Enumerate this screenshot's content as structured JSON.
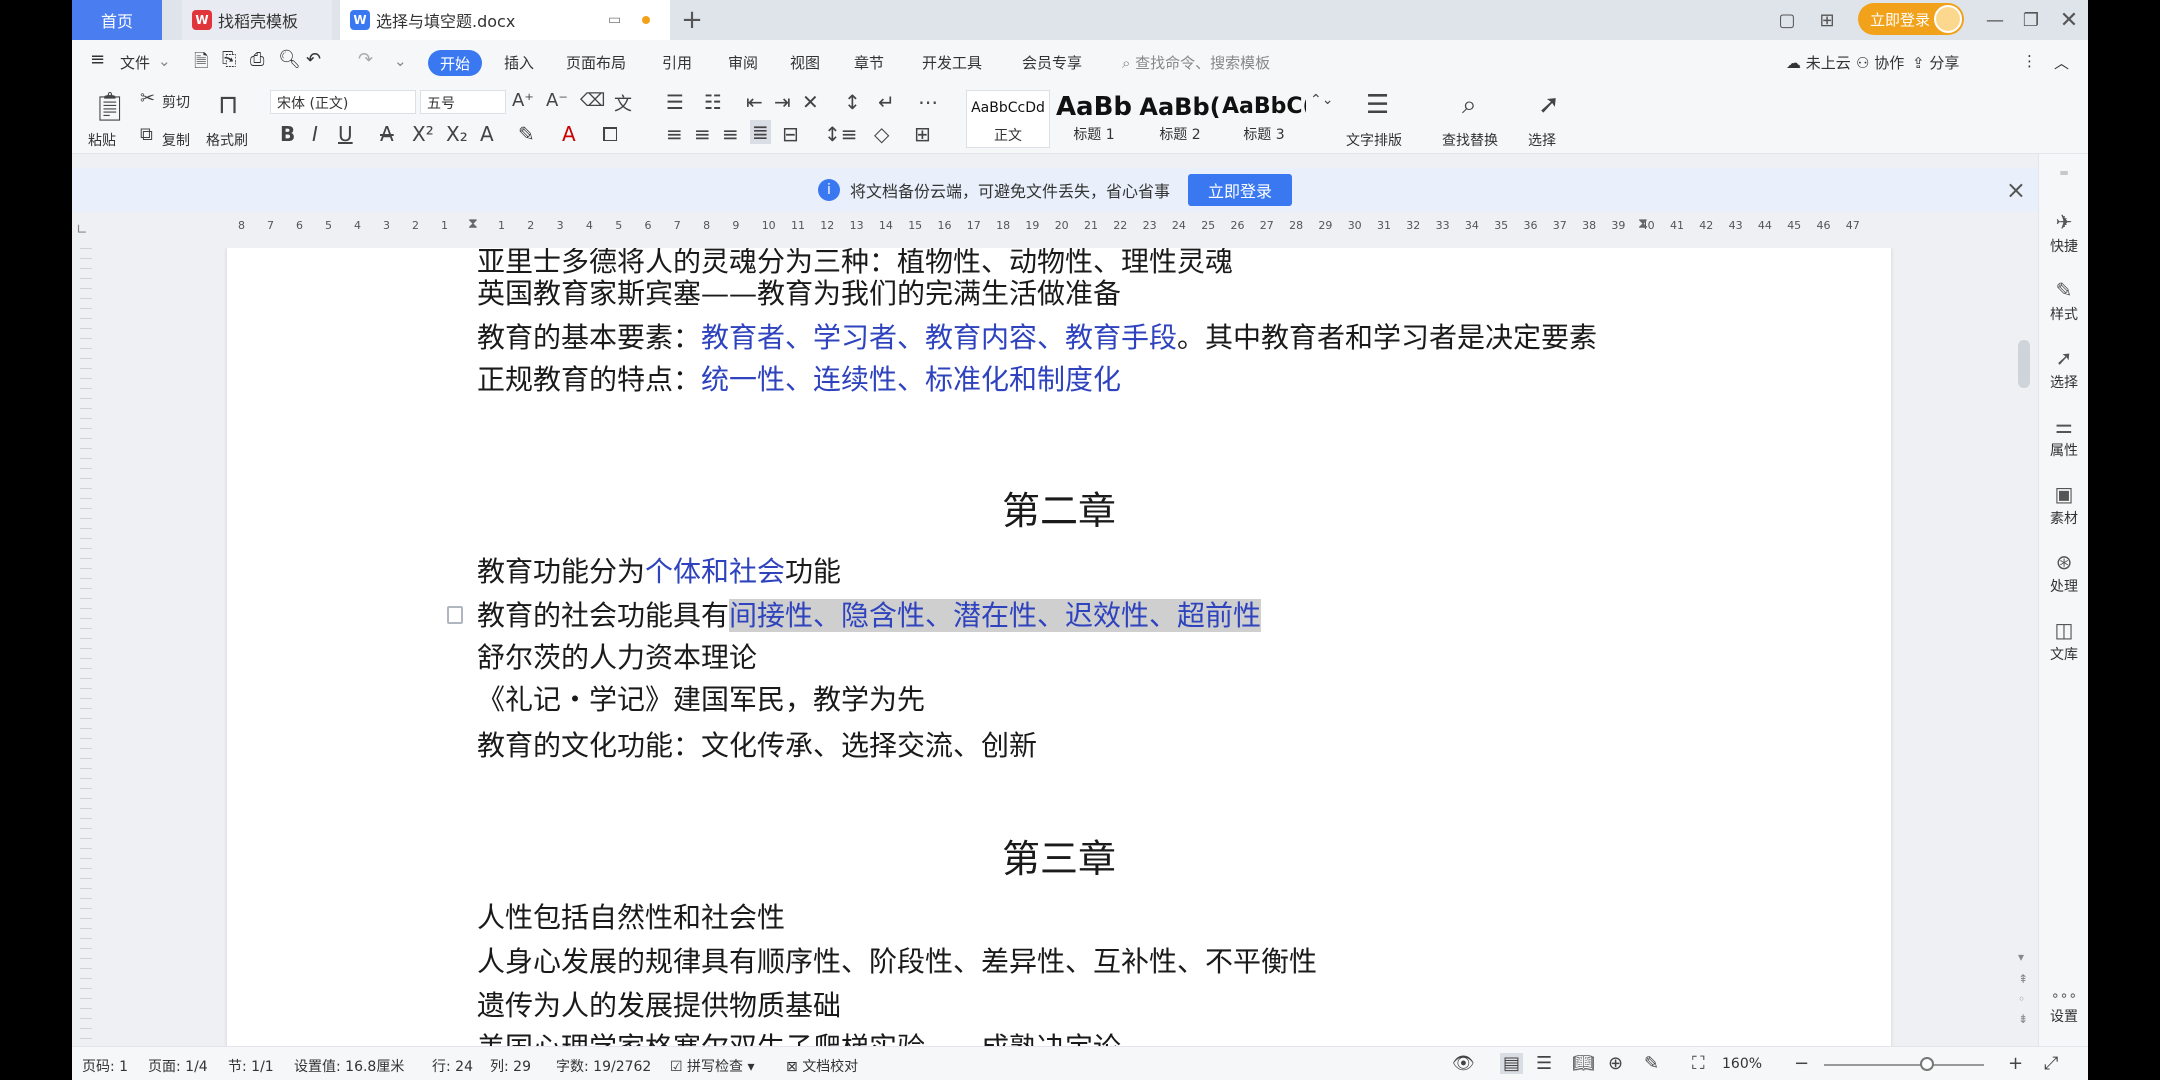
{
  "tabs": {
    "home": "首页",
    "template": "找稻壳模板",
    "doc": "选择与填空题.docx",
    "add": "+"
  },
  "window": {
    "login": "立即登录"
  },
  "menu": {
    "file": "文件",
    "items": [
      "开始",
      "插入",
      "页面布局",
      "引用",
      "审阅",
      "视图",
      "章节",
      "开发工具",
      "会员专享"
    ],
    "search_placeholder": "查找命令、搜索模板",
    "cloud": "未上云",
    "collab": "协作",
    "share": "分享"
  },
  "ribbon": {
    "paste": "粘贴",
    "cut": "剪切",
    "copy": "复制",
    "format_painter": "格式刷",
    "font_name": "宋体 (正文)",
    "font_size": "五号",
    "styles": [
      {
        "preview": "AaBbCcDd",
        "label": "正文"
      },
      {
        "preview": "AaBb",
        "label": "标题 1"
      },
      {
        "preview": "AaBb(",
        "label": "标题 2"
      },
      {
        "preview": "AaBbC(",
        "label": "标题 3"
      }
    ],
    "text_layout": "文字排版",
    "find_replace": "查找替换",
    "select": "选择"
  },
  "banner": {
    "message": "将文档备份云端，可避免文件丢失，省心省事",
    "button": "立即登录"
  },
  "ruler": {
    "left": [
      "8",
      "7",
      "6",
      "5",
      "4",
      "3",
      "2",
      "1"
    ],
    "right": [
      "1",
      "2",
      "3",
      "4",
      "5",
      "6",
      "7",
      "8",
      "9",
      "10",
      "11",
      "12",
      "13",
      "14",
      "15",
      "16",
      "17",
      "18",
      "19",
      "20",
      "21",
      "22",
      "23",
      "24",
      "25",
      "26",
      "27",
      "28",
      "29",
      "30",
      "31",
      "32",
      "33",
      "34",
      "35",
      "36",
      "37",
      "38",
      "39",
      "40",
      "41",
      "42",
      "43",
      "44",
      "45",
      "46",
      "47"
    ]
  },
  "document": {
    "l1": "亚里士多德将人的灵魂分为三种：植物性、动物性、理性灵魂",
    "l2": "英国教育家斯宾塞——教育为我们的完满生活做准备",
    "l3a": "教育的基本要素：",
    "l3b": "教育者、学习者、教育内容、教育手段",
    "l3c": "。其中教育者和学习者是决定要素",
    "l4a": "正规教育的特点：",
    "l4b": "统一性、连续性、标准化和制度化",
    "h2": "第二章",
    "l5a": "教育功能分为",
    "l5b": "个体和社会",
    "l5c": "功能",
    "l6a": "教育的社会功能具有",
    "l6b": "间接性、隐含性、潜在性、迟效性、超前性",
    "l7": "舒尔茨的人力资本理论",
    "l8": "《礼记・学记》建国军民，教学为先",
    "l9": "教育的文化功能：文化传承、选择交流、创新",
    "h3": "第三章",
    "l10": "人性包括自然性和社会性",
    "l11": "人身心发展的规律具有顺序性、阶段性、差异性、互补性、不平衡性",
    "l12": "遗传为人的发展提供物质基础",
    "l13": "美国心理学家格塞尔双生子爬梯实验——成熟决定论"
  },
  "right_panel": [
    "快捷",
    "样式",
    "选择",
    "属性",
    "素材",
    "处理",
    "文库",
    "设置"
  ],
  "status": {
    "page_num": "页码: 1",
    "pages": "页面: 1/4",
    "section": "节: 1/1",
    "setting": "设置值: 16.8厘米",
    "row": "行: 24",
    "col": "列: 29",
    "words": "字数: 19/2762",
    "spell": "拼写检查",
    "proof": "文档校对",
    "zoom": "160%"
  },
  "colors": {
    "accent": "#3a78f2",
    "doc_blue": "#2e43bd",
    "login": "#f2a21a"
  }
}
